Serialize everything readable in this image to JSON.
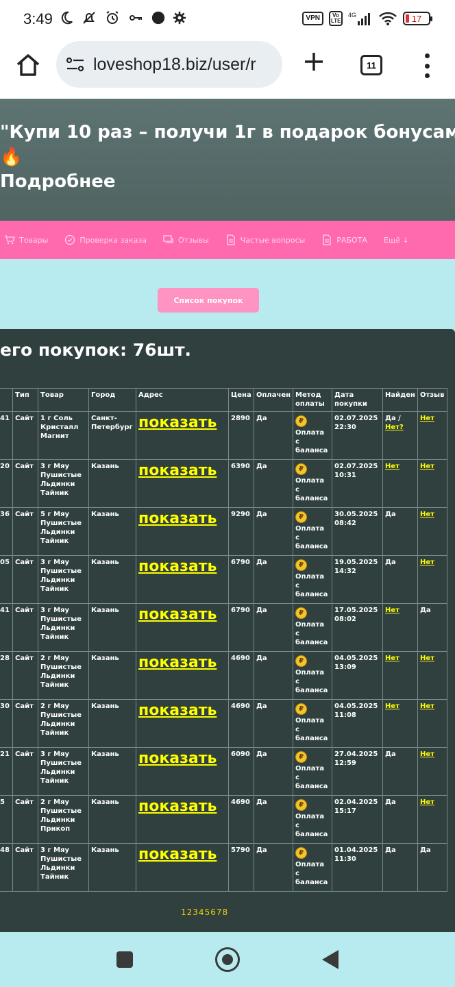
{
  "status_bar": {
    "time": "3:49",
    "vpn": "VPN",
    "volte": "Vo LTE",
    "network": "4G",
    "battery": "17"
  },
  "browser": {
    "url": "loveshop18.biz/user/r",
    "tab_count": "11"
  },
  "promo": {
    "line1": "\"Купи 10 раз – получи 1г в подарок бонусам",
    "fire": "🔥",
    "more": "Подробнее"
  },
  "nav": {
    "items": [
      {
        "label": "Товары",
        "icon": "cart-icon"
      },
      {
        "label": "Проверка заказа",
        "icon": "check-circle-icon"
      },
      {
        "label": "Отзывы",
        "icon": "chat-icon"
      },
      {
        "label": "Частые вопросы",
        "icon": "document-icon"
      },
      {
        "label": "РАБОТА",
        "icon": "document-icon"
      },
      {
        "label": "Ещё ↓",
        "icon": ""
      }
    ]
  },
  "purchase_list_button": "Список покупок",
  "panel": {
    "title": "его покупок: 76шт."
  },
  "table": {
    "headers": [
      "",
      "Тип",
      "Товар",
      "Город",
      "Адрес",
      "Цена",
      "Оплачен",
      "Метод оплаты",
      "Дата покупки",
      "Найден",
      "Отзыв"
    ],
    "rows": [
      {
        "id": "41",
        "type": "Сайт",
        "product": "1 г Соль Кристалл Магнит",
        "city": "Санкт-Петербург",
        "address": "показать",
        "price": "2890",
        "paid": "Да",
        "method": "Оплата с баланса",
        "date": "02.07.2025 22:30",
        "found": "Да /",
        "found_link": "Нет?",
        "review": "",
        "review_link": "Нет"
      },
      {
        "id": "20",
        "type": "Сайт",
        "product": "3 г Мяу Пушистые Льдинки Тайник",
        "city": "Казань",
        "address": "показать",
        "price": "6390",
        "paid": "Да",
        "method": "Оплата с баланса",
        "date": "02.07.2025 10:31",
        "found": "",
        "found_link": "Нет",
        "review": "",
        "review_link": "Нет"
      },
      {
        "id": "36",
        "type": "Сайт",
        "product": "5 г Мяу Пушистые Льдинки Тайник",
        "city": "Казань",
        "address": "показать",
        "price": "9290",
        "paid": "Да",
        "method": "Оплата с баланса",
        "date": "30.05.2025 08:42",
        "found": "Да",
        "found_link": "",
        "review": "",
        "review_link": "Нет"
      },
      {
        "id": "05",
        "type": "Сайт",
        "product": "3 г Мяу Пушистые Льдинки Тайник",
        "city": "Казань",
        "address": "показать",
        "price": "6790",
        "paid": "Да",
        "method": "Оплата с баланса",
        "date": "19.05.2025 14:32",
        "found": "Да",
        "found_link": "",
        "review": "",
        "review_link": "Нет"
      },
      {
        "id": "41",
        "type": "Сайт",
        "product": "3 г Мяу Пушистые Льдинки Тайник",
        "city": "Казань",
        "address": "показать",
        "price": "6790",
        "paid": "Да",
        "method": "Оплата с баланса",
        "date": "17.05.2025 08:02",
        "found": "",
        "found_link": "Нет",
        "review": "Да",
        "review_link": ""
      },
      {
        "id": "28",
        "type": "Сайт",
        "product": "2 г Мяу Пушистые Льдинки Тайник",
        "city": "Казань",
        "address": "показать",
        "price": "4690",
        "paid": "Да",
        "method": "Оплата с баланса",
        "date": "04.05.2025 13:09",
        "found": "",
        "found_link": "Нет",
        "review": "",
        "review_link": "Нет"
      },
      {
        "id": "30",
        "type": "Сайт",
        "product": "2 г Мяу Пушистые Льдинки Тайник",
        "city": "Казань",
        "address": "показать",
        "price": "4690",
        "paid": "Да",
        "method": "Оплата с баланса",
        "date": "04.05.2025 11:08",
        "found": "",
        "found_link": "Нет",
        "review": "",
        "review_link": "Нет"
      },
      {
        "id": "21",
        "type": "Сайт",
        "product": "3 г Мяу Пушистые Льдинки Тайник",
        "city": "Казань",
        "address": "показать",
        "price": "6090",
        "paid": "Да",
        "method": "Оплата с баланса",
        "date": "27.04.2025 12:59",
        "found": "Да",
        "found_link": "",
        "review": "",
        "review_link": "Нет"
      },
      {
        "id": "5",
        "type": "Сайт",
        "product": "2 г Мяу Пушистые Льдинки Прикоп",
        "city": "Казань",
        "address": "показать",
        "price": "4690",
        "paid": "Да",
        "method": "Оплата с баланса",
        "date": "02.04.2025 15:17",
        "found": "Да",
        "found_link": "",
        "review": "",
        "review_link": "Нет"
      },
      {
        "id": "48",
        "type": "Сайт",
        "product": "3 г Мяу Пушистые Льдинки Тайник",
        "city": "Казань",
        "address": "показать",
        "price": "5790",
        "paid": "Да",
        "method": "Оплата с баланса",
        "date": "01.04.2025 11:30",
        "found": "Да",
        "found_link": "",
        "review": "Да",
        "review_link": ""
      }
    ]
  },
  "pagination": [
    "1",
    "2",
    "3",
    "4",
    "5",
    "6",
    "7",
    "8"
  ],
  "colors": {
    "accent_pink": "#ff69ad",
    "link_yellow": "#ffff00",
    "panel_bg": "#2f403f",
    "page_bg": "#b8ebef"
  }
}
